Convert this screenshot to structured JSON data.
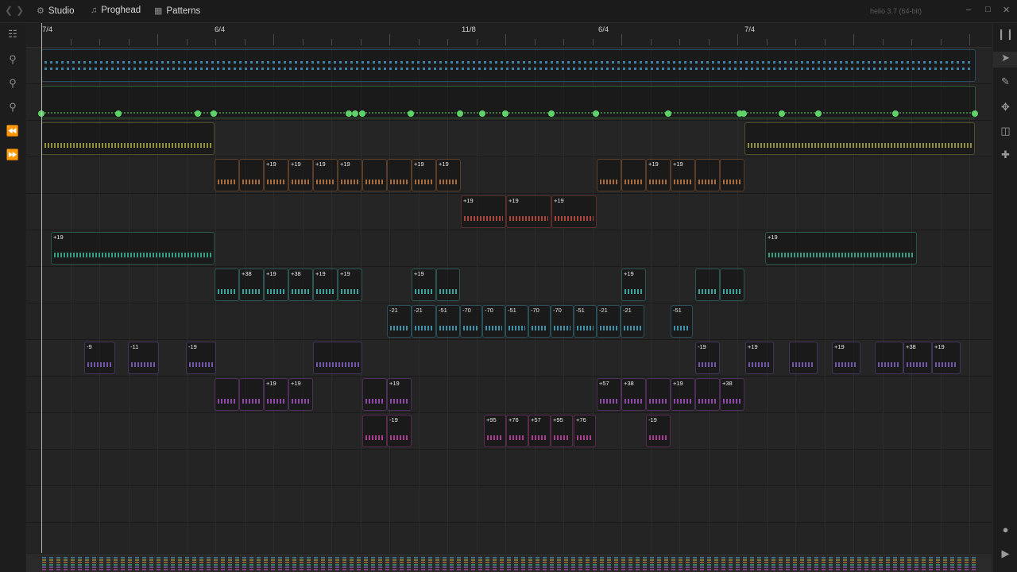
{
  "titlebar": {
    "tabs": [
      {
        "label": "Studio",
        "icon": "gear-icon"
      },
      {
        "label": "Proghead",
        "icon": "note-icon"
      },
      {
        "label": "Patterns",
        "icon": "patterns-icon"
      }
    ],
    "app_version": "helio 3.7 (64-bit)"
  },
  "ruler": {
    "time_signatures": [
      "7/4",
      "6/4",
      "11/8",
      "6/4",
      "7/4"
    ]
  },
  "colors": {
    "blue": "#4aa6d4",
    "green": "#5fd36a",
    "olive": "#b7b84a",
    "orange": "#d9874a",
    "red": "#d9564a",
    "teal": "#3fc9a0",
    "cyan": "#4ad0c9",
    "lightblue": "#4ab9d9",
    "violet": "#8f6ad9",
    "purple": "#b55ad9",
    "magenta": "#d94ab5"
  },
  "lanes": [
    {
      "color": "blue",
      "clips": [
        {
          "label": ""
        }
      ]
    },
    {
      "color": "green",
      "clips": [
        {
          "label": ""
        }
      ]
    },
    {
      "color": "olive",
      "clips": [
        {
          "label": ""
        },
        {
          "label": ""
        }
      ]
    },
    {
      "color": "orange",
      "clips": [
        "",
        "",
        "+19",
        "+19",
        "+19",
        "+19",
        "",
        "",
        "+19",
        "+19",
        "",
        "",
        "+19",
        "+19",
        "",
        ""
      ]
    },
    {
      "color": "red",
      "clips": [
        "+19",
        "+19",
        "+19"
      ]
    },
    {
      "color": "teal",
      "clips": [
        "+19",
        "+19"
      ]
    },
    {
      "color": "cyan",
      "clips": [
        "",
        "+38",
        "+19",
        "+38",
        "+19",
        "+19",
        "+19",
        "",
        "+19",
        "",
        ""
      ]
    },
    {
      "color": "lightblue",
      "clips": [
        "-21",
        "-21",
        "-51",
        "-70",
        "-70",
        "-51",
        "-70",
        "-70",
        "-51",
        "-21",
        "-21",
        "-51"
      ]
    },
    {
      "color": "violet",
      "clips": [
        "-9",
        "-11",
        "-19",
        "",
        "-19",
        "+19",
        "",
        "+19",
        "",
        "+38",
        "+19",
        "+38"
      ]
    },
    {
      "color": "purple",
      "clips": [
        "",
        "",
        "+19",
        "+19",
        "",
        "+19",
        "+57",
        "+38",
        "",
        "+19",
        "",
        "+38"
      ]
    },
    {
      "color": "magenta",
      "clips": [
        "",
        "-19",
        "+95",
        "+76",
        "+57",
        "+95",
        "+76",
        "-19"
      ]
    }
  ]
}
